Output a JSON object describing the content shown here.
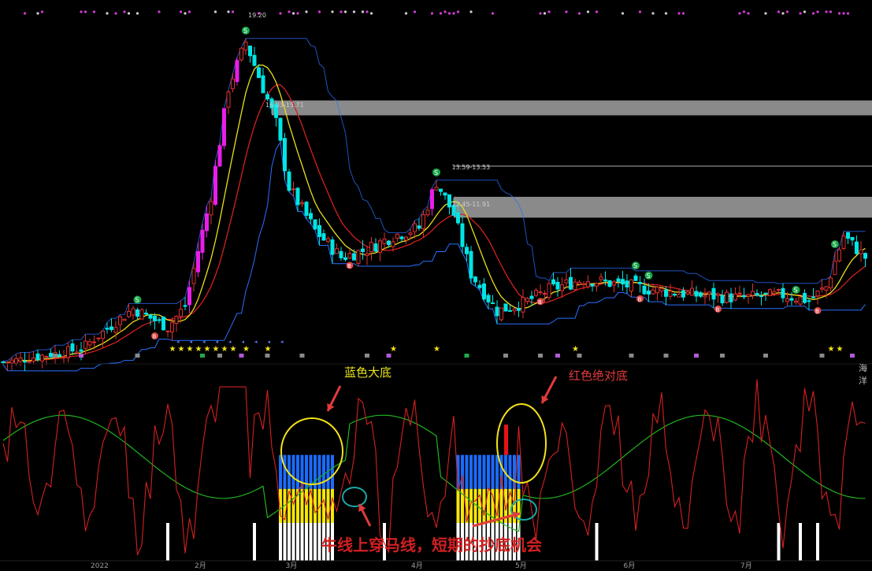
{
  "chart_data": [
    {
      "type": "candlestick",
      "title": "",
      "price_labels": [
        {
          "id": "high",
          "text": "19.20",
          "value": 19.2,
          "idx": 56
        },
        {
          "id": "zone1",
          "text": "16.03-15.71",
          "value": 15.87,
          "idx": 60
        },
        {
          "id": "zone2",
          "text": "13.59-13.53",
          "value": 13.56,
          "idx": 103
        },
        {
          "id": "zone3",
          "text": "12.45-11.91",
          "value": 12.18,
          "idx": 103
        }
      ],
      "resistance_zones": [
        {
          "lo": 15.71,
          "hi": 16.03,
          "from_idx": 62,
          "band": true
        },
        {
          "lo": 13.53,
          "hi": 13.59,
          "from_idx": 104,
          "band": false
        },
        {
          "lo": 11.91,
          "hi": 12.45,
          "from_idx": 104,
          "band": true
        }
      ],
      "markers": {
        "sell": [
          31,
          56,
          100,
          146,
          149,
          183,
          192
        ],
        "buy": [
          35,
          80,
          124,
          147,
          165,
          188
        ]
      },
      "yellow_stars": [
        39,
        41,
        43,
        45,
        47,
        49,
        51,
        53,
        56,
        61,
        90,
        100,
        132,
        191,
        193
      ],
      "x_axis": {
        "ticks": [
          {
            "label": "2022",
            "idx": 22
          },
          {
            "label": "2月",
            "idx": 46
          },
          {
            "label": "3月",
            "idx": 67
          },
          {
            "label": "4月",
            "idx": 96
          },
          {
            "label": "5月",
            "idx": 120
          },
          {
            "label": "6月",
            "idx": 145
          },
          {
            "label": "7月",
            "idx": 172
          }
        ]
      },
      "corner_label": "海洋"
    },
    {
      "type": "line",
      "series": [
        {
          "color": "#d42020",
          "style": "oscillator"
        },
        {
          "color": "#1fb31f",
          "style": "smooth"
        }
      ],
      "signal_zones": [
        {
          "label": "蓝色大底",
          "from_idx": 64,
          "to_idx": 76,
          "blue": true,
          "yellow": true,
          "white": true
        },
        {
          "label": "红色绝对底",
          "from_idx": 105,
          "to_idx": 119,
          "blue": true,
          "yellow": true,
          "white": true,
          "red_bar_idx": 116
        }
      ],
      "white_bars": [
        38,
        58,
        88,
        137,
        179,
        184,
        188
      ]
    }
  ],
  "annotations": {
    "blue_bottom": "蓝色大底",
    "red_bottom": "红色绝对底",
    "cross_note": "牛线上穿马线，短期的抄底机会"
  },
  "colors": {
    "up": "#e03030",
    "down": "#00e5e5",
    "big_up": "#e81ee8",
    "ma_yellow": "#e8e01a",
    "ma_red": "#d42020",
    "channel": "#2a6fff",
    "oscillator_red": "#d42020",
    "oscillator_green": "#1fb31f",
    "signal_blue": "#1a6cff",
    "signal_yellow": "#f5e60a",
    "annotation_red": "#e23b3b"
  }
}
